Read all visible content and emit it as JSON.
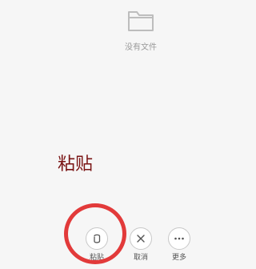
{
  "empty_state": {
    "icon": "folder-icon",
    "text": "没有文件"
  },
  "annotation": {
    "text": "粘贴",
    "color": "#7a1414"
  },
  "highlight": {
    "color": "#e23a3a",
    "target": "paste"
  },
  "actions": [
    {
      "icon": "paste-icon",
      "label": "粘贴"
    },
    {
      "icon": "close-icon",
      "label": "取消"
    },
    {
      "icon": "more-icon",
      "label": "更多"
    }
  ]
}
